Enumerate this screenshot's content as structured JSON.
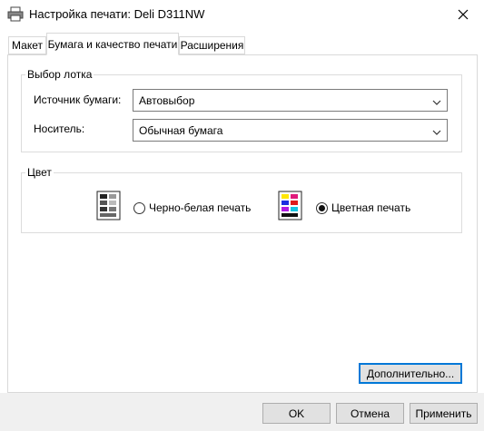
{
  "window": {
    "title": "Настройка печати: Deli D311NW"
  },
  "tabs": [
    {
      "label": "Макет"
    },
    {
      "label": "Бумага и качество печати"
    },
    {
      "label": "Расширения"
    }
  ],
  "tray_group": {
    "legend": "Выбор лотка",
    "source_label": "Источник бумаги:",
    "source_value": "Автовыбор",
    "media_label": "Носитель:",
    "media_value": "Обычная бумага"
  },
  "color_group": {
    "legend": "Цвет",
    "bw_label": "Черно-белая печать",
    "color_label": "Цветная печать",
    "selected": "color"
  },
  "buttons": {
    "advanced": "Дополнительно...",
    "ok": "OK",
    "cancel": "Отмена",
    "apply": "Применить"
  }
}
